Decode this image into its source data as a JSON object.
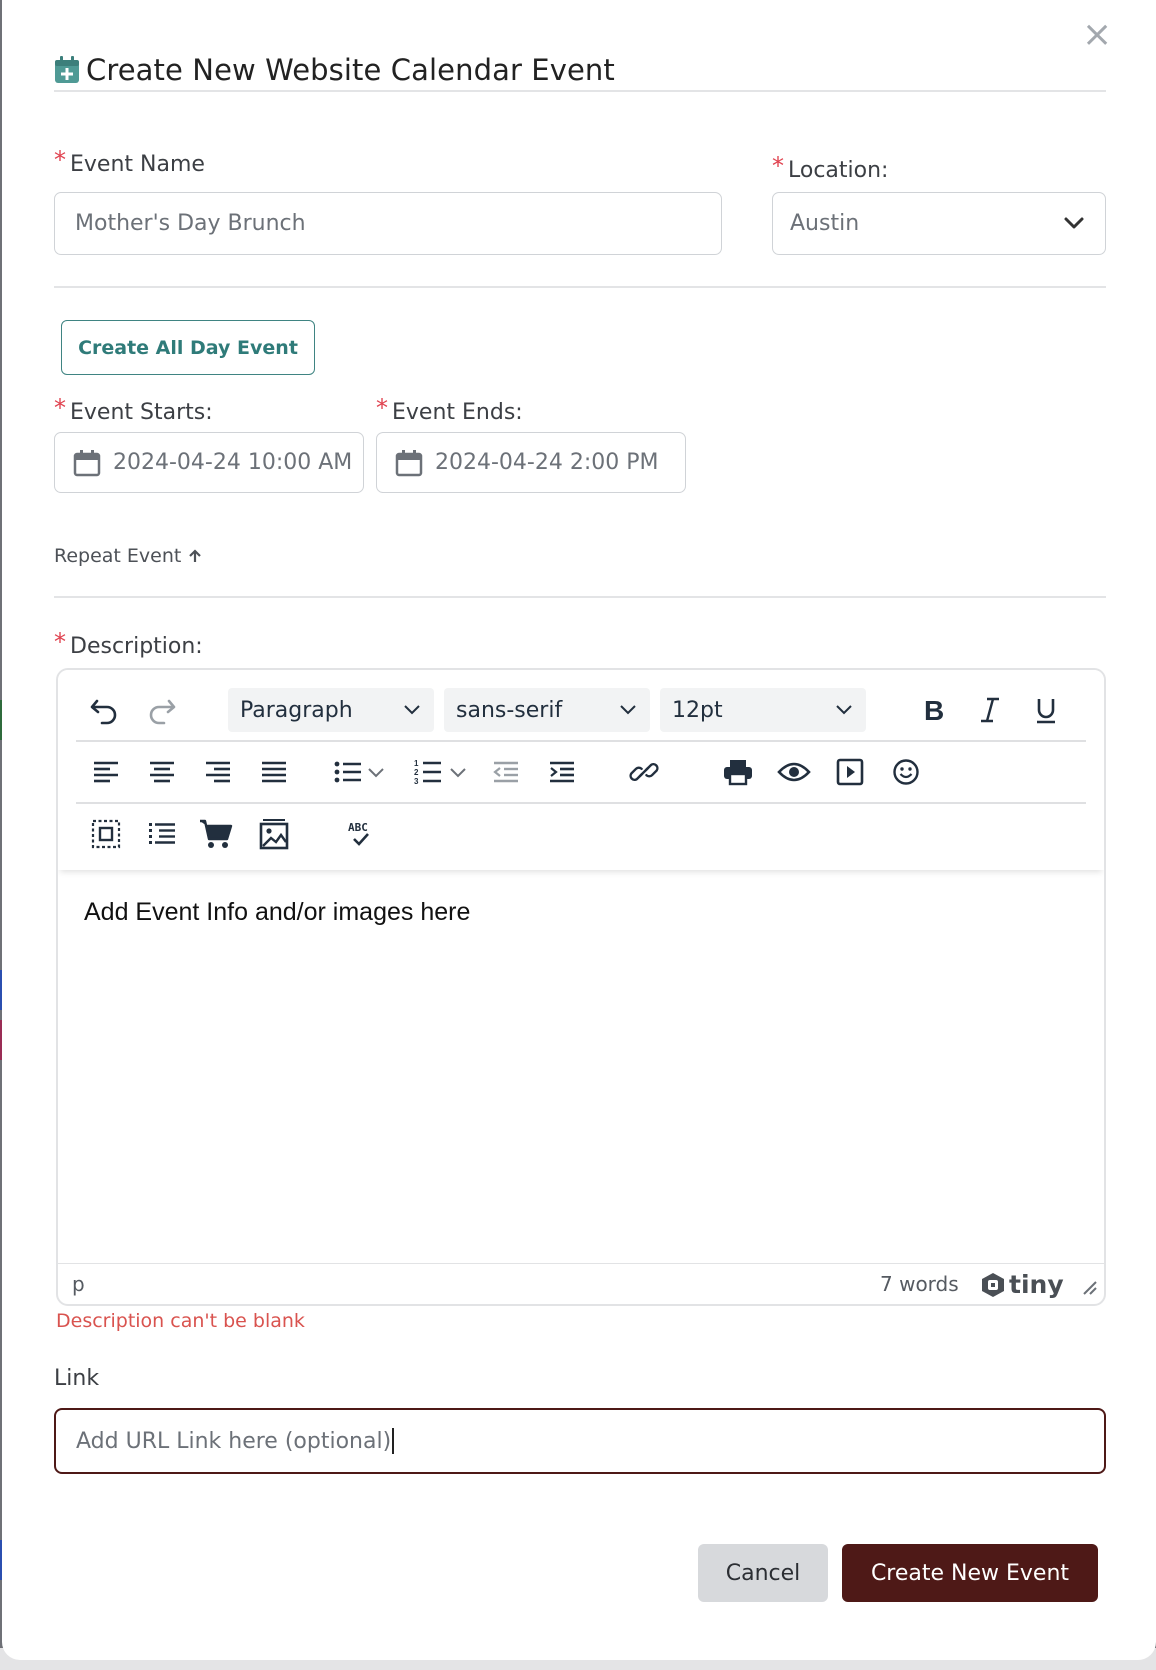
{
  "modal": {
    "title": "Create New Website Calendar Event",
    "close_symbol": "×"
  },
  "event_name": {
    "label": "Event Name",
    "value": "Mother's Day Brunch"
  },
  "location": {
    "label": "Location:",
    "selected": "Austin"
  },
  "all_day_button": "Create All Day Event",
  "event_starts": {
    "label": "Event Starts:",
    "value": "2024-04-24 10:00 AM"
  },
  "event_ends": {
    "label": "Event Ends:",
    "value": "2024-04-24 2:00 PM"
  },
  "repeat_event": "Repeat Event",
  "description": {
    "label": "Description:",
    "block_format": "Paragraph",
    "font_family": "sans-serif",
    "font_size": "12pt",
    "content": "Add Event Info and/or images here",
    "status_path": "p",
    "word_count": "7 words",
    "brand": "tiny",
    "error": "Description can't be blank"
  },
  "link": {
    "label": "Link",
    "placeholder": "Add URL Link here (optional)"
  },
  "actions": {
    "cancel": "Cancel",
    "submit": "Create New Event"
  },
  "colors": {
    "accent_teal": "#2f7b79",
    "primary_button": "#4e1917",
    "error_red": "#d9534f",
    "required_star": "#e0424f"
  },
  "icons": [
    "close-icon",
    "calendar-plus-icon",
    "chevron-down-icon",
    "calendar-icon",
    "arrow-up-icon",
    "undo-icon",
    "redo-icon",
    "bold-icon",
    "italic-icon",
    "underline-icon",
    "align-left-icon",
    "align-center-icon",
    "align-right-icon",
    "align-justify-icon",
    "bullet-list-icon",
    "numbered-list-icon",
    "outdent-icon",
    "indent-icon",
    "link-icon",
    "print-icon",
    "preview-icon",
    "media-icon",
    "emoticon-icon",
    "visual-blocks-icon",
    "table-of-contents-icon",
    "cart-icon",
    "image-icon",
    "spellcheck-icon",
    "resize-handle-icon"
  ]
}
